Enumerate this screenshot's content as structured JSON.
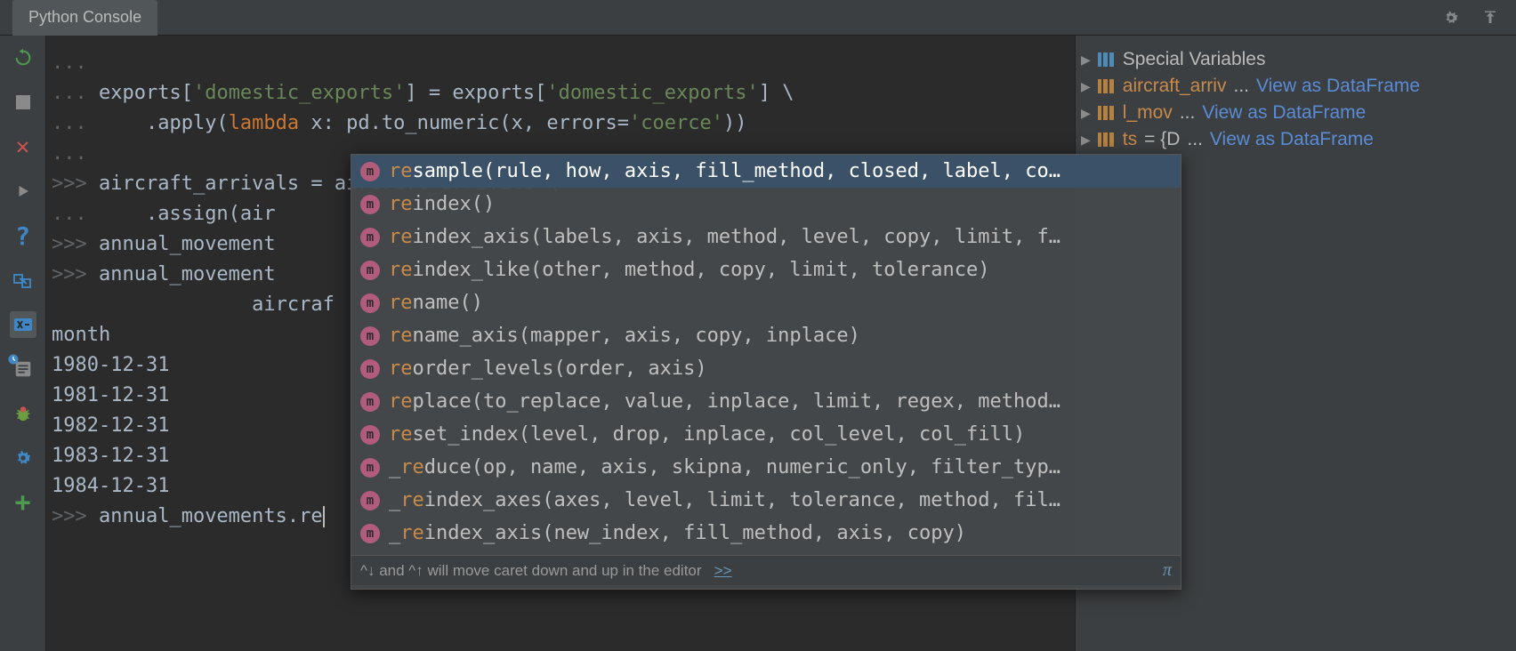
{
  "tabs": {
    "console_label": "Python Console"
  },
  "toolbar_icons": {
    "rerun": "rerun-icon",
    "stop": "stop-icon",
    "close": "close-icon",
    "run": "run-icon",
    "help": "help-icon",
    "attach": "attach-icon",
    "variables": "variables-icon",
    "history": "history-icon",
    "debug": "debug-icon",
    "settings": "settings-icon",
    "add": "add-icon"
  },
  "top_right_icons": {
    "gear": "gear-icon",
    "hide": "hide-icon"
  },
  "console": {
    "lines": [
      {
        "gutter": "...",
        "text": ""
      },
      {
        "gutter": "...",
        "segments": [
          {
            "t": "exports[",
            "c": "normal"
          },
          {
            "t": "'domestic_exports'",
            "c": "str"
          },
          {
            "t": "] = exports[",
            "c": "normal"
          },
          {
            "t": "'domestic_exports'",
            "c": "str"
          },
          {
            "t": "] \\",
            "c": "normal"
          }
        ]
      },
      {
        "gutter": "...",
        "segments": [
          {
            "t": "    .apply(",
            "c": "normal"
          },
          {
            "t": "lambda",
            "c": "kw"
          },
          {
            "t": " x: pd.to_numeric(x, errors=",
            "c": "normal"
          },
          {
            "t": "'coerce'",
            "c": "str"
          },
          {
            "t": "))",
            "c": "normal"
          }
        ]
      },
      {
        "gutter": "...",
        "text": ""
      },
      {
        "gutter": ">>>",
        "text": "aircraft_arrivals = aircraft_arrivals \\"
      },
      {
        "gutter": "...",
        "text": "    .assign(air"
      },
      {
        "gutter": ">>>",
        "text": "annual_movement"
      },
      {
        "gutter": ">>>",
        "text": "annual_movement"
      },
      {
        "gutter": "   ",
        "text": "             aircraf"
      },
      {
        "gutter": "",
        "text": "month"
      },
      {
        "gutter": "",
        "text": "1980-12-31"
      },
      {
        "gutter": "",
        "text": "1981-12-31"
      },
      {
        "gutter": "",
        "text": "1982-12-31"
      },
      {
        "gutter": "",
        "text": "1983-12-31"
      },
      {
        "gutter": "",
        "text": "1984-12-31"
      },
      {
        "gutter": "",
        "text": ""
      },
      {
        "gutter": ">>>",
        "text": "annual_movements.re",
        "cursor": true
      }
    ]
  },
  "autocomplete": {
    "items": [
      {
        "hl": "re",
        "rest": "sample(rule, how, axis, fill_method, closed, label, co…",
        "selected": true
      },
      {
        "hl": "re",
        "rest": "index()"
      },
      {
        "hl": "re",
        "rest": "index_axis(labels, axis, method, level, copy, limit, f…"
      },
      {
        "hl": "re",
        "rest": "index_like(other, method, copy, limit, tolerance)"
      },
      {
        "hl": "re",
        "rest": "name()"
      },
      {
        "hl": "re",
        "rest": "name_axis(mapper, axis, copy, inplace)"
      },
      {
        "hl": "re",
        "rest": "order_levels(order, axis)"
      },
      {
        "hl": "re",
        "rest": "place(to_replace, value, inplace, limit, regex, method…"
      },
      {
        "hl": "re",
        "rest": "set_index(level, drop, inplace, col_level, col_fill)"
      },
      {
        "prefix": "_",
        "hl": "re",
        "rest": "duce(op, name, axis, skipna, numeric_only, filter_typ…"
      },
      {
        "prefix": "_",
        "hl": "re",
        "rest": "index_axes(axes, level, limit, tolerance, method, fil…"
      },
      {
        "prefix": "_",
        "hl": "re",
        "rest": "index_axis(new_index, fill_method, axis, copy)"
      }
    ],
    "hint_text": "^↓ and ^↑ will move caret down and up in the editor",
    "hint_link": ">>",
    "pi": "π"
  },
  "variables": {
    "special_label": "Special Variables",
    "items": [
      {
        "name": "aircraft_arriv",
        "ell": "...",
        "link": "View as DataFrame",
        "color": "blue"
      },
      {
        "name": "l_mov",
        "ell": "...",
        "link": "View as DataFrame",
        "color": "orange"
      },
      {
        "name": "ts",
        "assign": " = {D",
        "ell": "...",
        "link": "View as DataFrame",
        "color": "orange"
      }
    ]
  }
}
